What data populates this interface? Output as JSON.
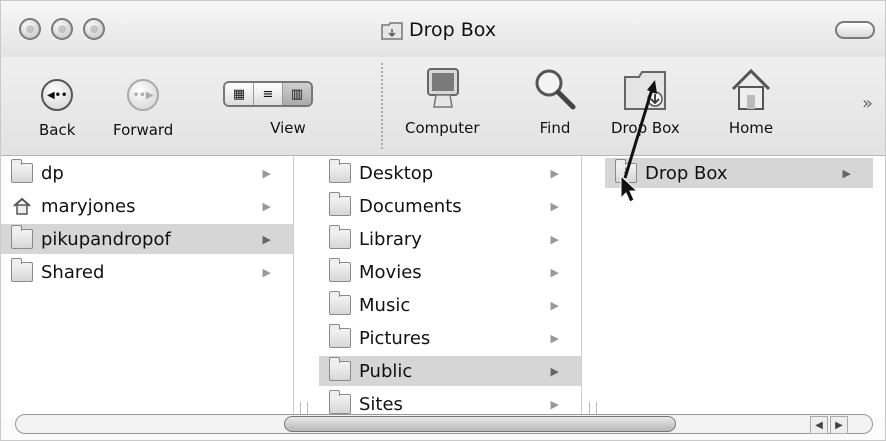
{
  "window": {
    "title": "Drop Box"
  },
  "toolbar": {
    "back": "Back",
    "forward": "Forward",
    "view": "View",
    "computer": "Computer",
    "find": "Find",
    "dropbox": "Drop Box",
    "home": "Home"
  },
  "columns": [
    {
      "items": [
        {
          "label": "dp",
          "icon": "folder-icon"
        },
        {
          "label": "maryjones",
          "icon": "home-icon"
        },
        {
          "label": "pikupandropof",
          "icon": "folder-icon",
          "selected": true
        },
        {
          "label": "Shared",
          "icon": "folder-icon"
        }
      ]
    },
    {
      "items": [
        {
          "label": "Desktop",
          "icon": "folder-icon"
        },
        {
          "label": "Documents",
          "icon": "folder-icon"
        },
        {
          "label": "Library",
          "icon": "folder-icon"
        },
        {
          "label": "Movies",
          "icon": "folder-icon"
        },
        {
          "label": "Music",
          "icon": "folder-icon"
        },
        {
          "label": "Pictures",
          "icon": "folder-icon"
        },
        {
          "label": "Public",
          "icon": "folder-icon",
          "selected": true
        },
        {
          "label": "Sites",
          "icon": "folder-icon"
        }
      ]
    },
    {
      "items": [
        {
          "label": "Drop Box",
          "icon": "dropbox-folder-icon",
          "selected": true
        }
      ]
    }
  ]
}
